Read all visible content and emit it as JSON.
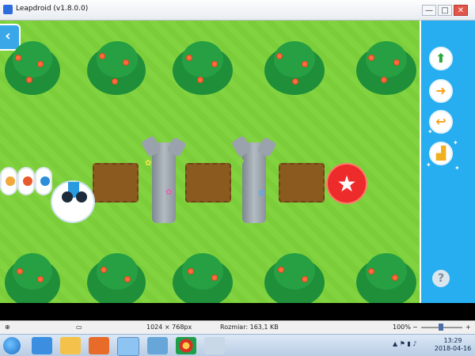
{
  "window": {
    "title": "Leapdroid (v1.8.0.0)",
    "minimize_label": "—",
    "maximize_label": "□",
    "close_label": "✕"
  },
  "game": {
    "back_label": "‹",
    "goal_symbol": "★"
  },
  "side_panel": {
    "commands": [
      {
        "icon": "up-arrow-icon",
        "label": "⬆",
        "color": "#2aa83a"
      },
      {
        "icon": "turn-right-icon",
        "label": "➜",
        "color": "#f5a21b"
      },
      {
        "icon": "turn-left-icon",
        "label": "↩",
        "color": "#f5a21b"
      },
      {
        "icon": "stairs-icon",
        "label": "▟",
        "color": "#f0b020"
      }
    ],
    "help_label": "?"
  },
  "statusbar": {
    "dimensions": "1024 × 768px",
    "size": "Rozmiar: 163,1 KB",
    "zoom": "100%",
    "zoom_minus": "−",
    "zoom_plus": "+"
  },
  "taskbar": {
    "time": "13:29",
    "date": "2018-04-16"
  },
  "colors": {
    "grass": "#7dd23a",
    "panel": "#27aef0",
    "goal": "#ee2b2b"
  }
}
